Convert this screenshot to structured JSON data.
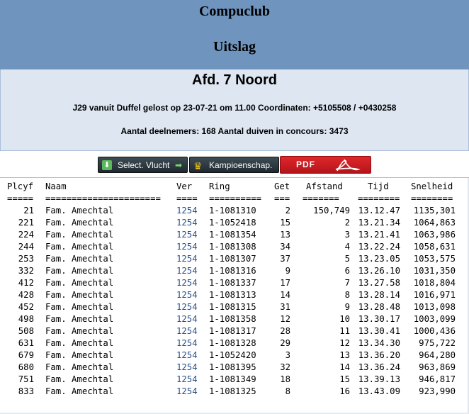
{
  "header": {
    "club": "Compuclub",
    "subtitle": "Uitslag"
  },
  "info": {
    "section": "Afd. 7 Noord",
    "release": "J29 vanuit Duffel gelost op 23-07-21 om 11.00 Coordinaten: +5105508 / +0430258",
    "counts": "Aantal deelnemers: 168 Aantal duiven in concours: 3473"
  },
  "buttons": {
    "select_label": "Select. Vlucht",
    "kamp_label": "Kampioenschap.",
    "pdf_label": "PDF",
    "icons": {
      "select": "download-icon",
      "select_arrow": "arrow-right-icon",
      "kamp": "crown-icon",
      "pdf": "acrobat-icon"
    }
  },
  "table": {
    "columns": [
      "Plcyf",
      "Naam",
      "Ver",
      "Ring",
      "Get",
      "Afstand",
      "Tijd",
      "Snelheid"
    ],
    "separators": [
      "=====",
      "======================",
      "====",
      "==========",
      "===",
      "=======",
      "========",
      "========"
    ],
    "rows": [
      [
        "21",
        "Fam. Amechtal",
        "1254",
        "1-1081310",
        "2",
        "150,749",
        "13.12.47",
        "1135,301"
      ],
      [
        "221",
        "Fam. Amechtal",
        "1254",
        "1-1052418",
        "15",
        "2",
        "13.21.34",
        "1064,863"
      ],
      [
        "224",
        "Fam. Amechtal",
        "1254",
        "1-1081354",
        "13",
        "3",
        "13.21.41",
        "1063,986"
      ],
      [
        "244",
        "Fam. Amechtal",
        "1254",
        "1-1081308",
        "34",
        "4",
        "13.22.24",
        "1058,631"
      ],
      [
        "253",
        "Fam. Amechtal",
        "1254",
        "1-1081307",
        "37",
        "5",
        "13.23.05",
        "1053,575"
      ],
      [
        "332",
        "Fam. Amechtal",
        "1254",
        "1-1081316",
        "9",
        "6",
        "13.26.10",
        "1031,350"
      ],
      [
        "412",
        "Fam. Amechtal",
        "1254",
        "1-1081337",
        "17",
        "7",
        "13.27.58",
        "1018,804"
      ],
      [
        "428",
        "Fam. Amechtal",
        "1254",
        "1-1081313",
        "14",
        "8",
        "13.28.14",
        "1016,971"
      ],
      [
        "452",
        "Fam. Amechtal",
        "1254",
        "1-1081315",
        "31",
        "9",
        "13.28.48",
        "1013,098"
      ],
      [
        "498",
        "Fam. Amechtal",
        "1254",
        "1-1081358",
        "12",
        "10",
        "13.30.17",
        "1003,099"
      ],
      [
        "508",
        "Fam. Amechtal",
        "1254",
        "1-1081317",
        "28",
        "11",
        "13.30.41",
        "1000,436"
      ],
      [
        "631",
        "Fam. Amechtal",
        "1254",
        "1-1081328",
        "29",
        "12",
        "13.34.30",
        "975,722"
      ],
      [
        "679",
        "Fam. Amechtal",
        "1254",
        "1-1052420",
        "3",
        "13",
        "13.36.20",
        "964,280"
      ],
      [
        "680",
        "Fam. Amechtal",
        "1254",
        "1-1081395",
        "32",
        "14",
        "13.36.24",
        "963,869"
      ],
      [
        "751",
        "Fam. Amechtal",
        "1254",
        "1-1081349",
        "18",
        "15",
        "13.39.13",
        "946,817"
      ],
      [
        "833",
        "Fam. Amechtal",
        "1254",
        "1-1081325",
        "8",
        "16",
        "13.43.09",
        "923,990"
      ]
    ]
  },
  "colors": {
    "header_bg": "#6f95bf",
    "info_bg": "#dde6f1",
    "ver_link": "#2a4f86",
    "pdf_red": "#d01f25"
  }
}
